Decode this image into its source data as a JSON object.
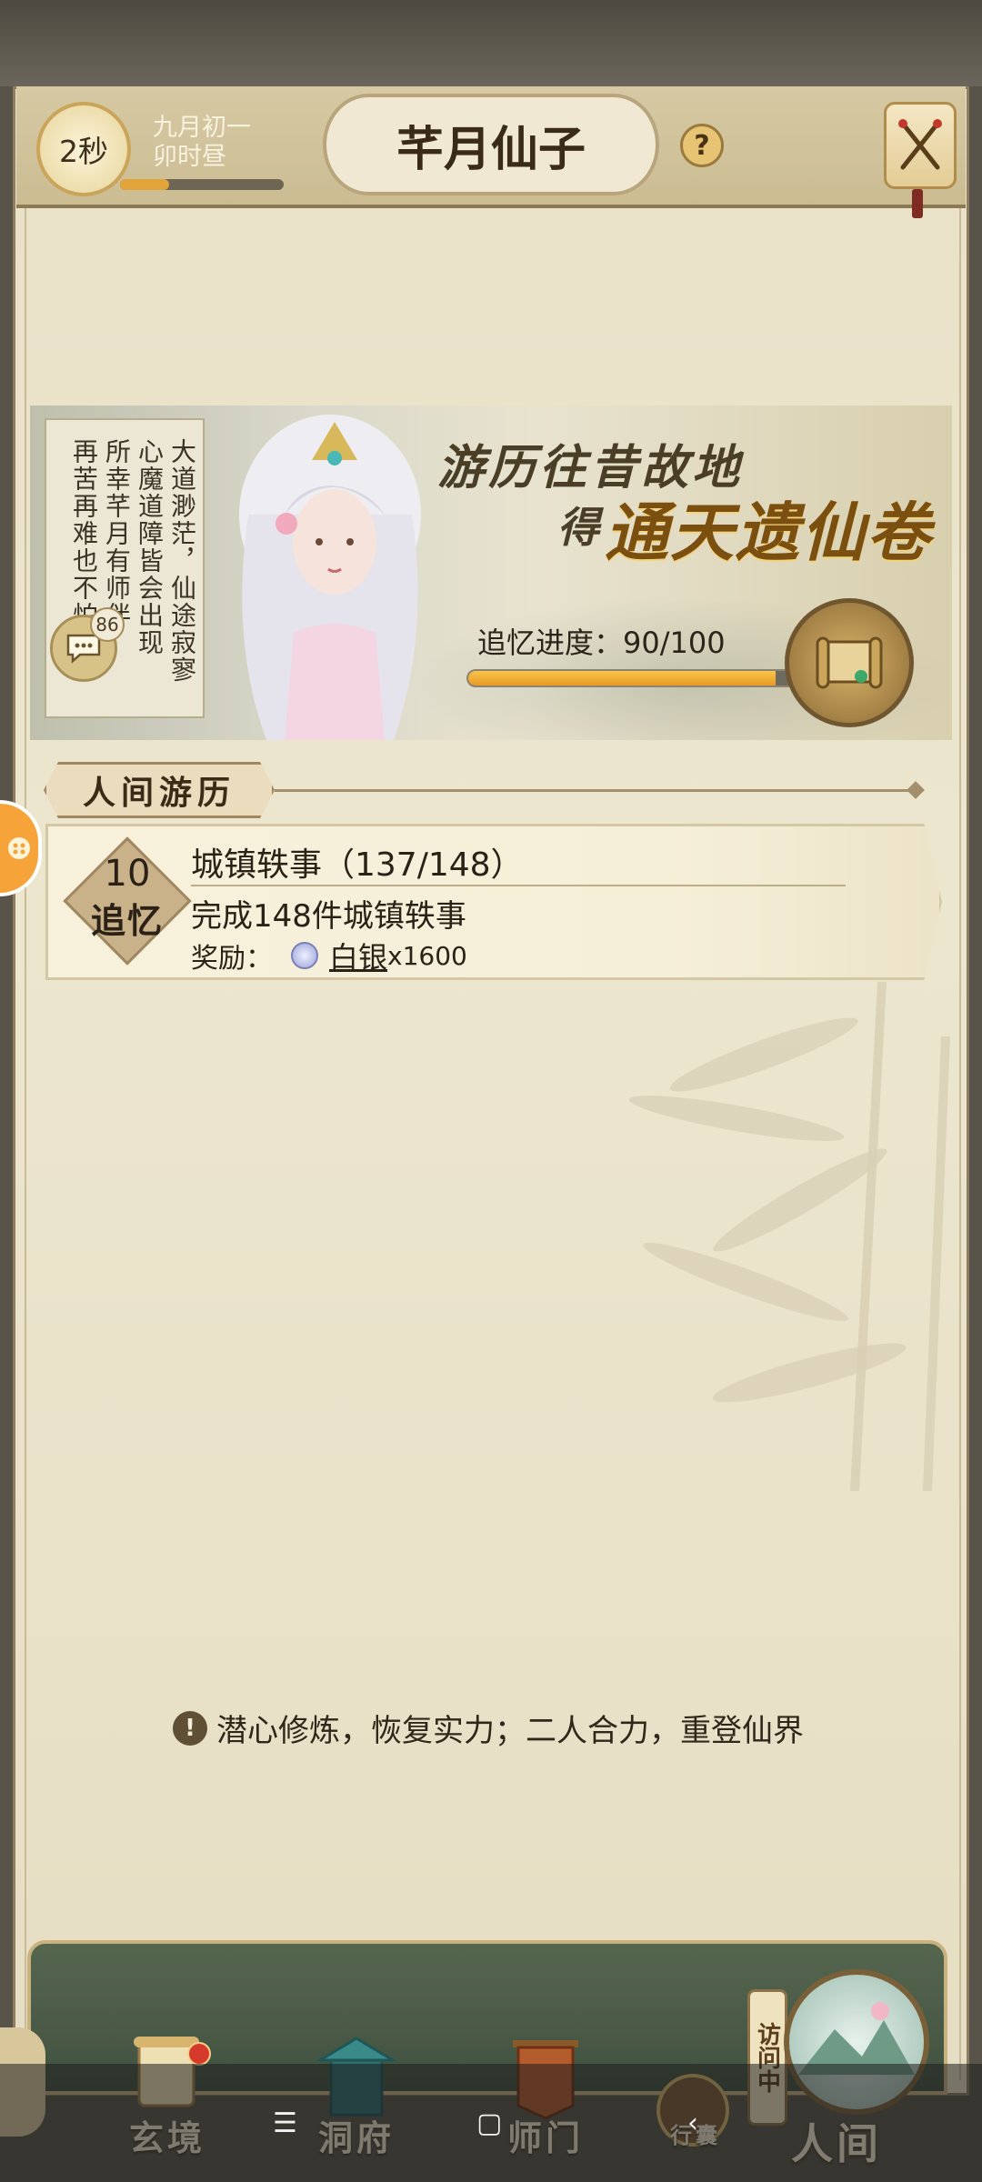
{
  "header": {
    "timer": "2秒",
    "date_line1": "九月初一",
    "date_line2": "卯时昼",
    "day_progress": 0.3,
    "title": "芊月仙子",
    "help_icon": "question-icon",
    "close_icon": "crossed-swords-icon"
  },
  "banner": {
    "poem_columns": [
      "大道渺茫，仙途寂寥",
      "心魔道障皆会出现",
      "所幸芊月有师伴",
      "再苦再难也不怕"
    ],
    "chat_badge": "86",
    "headline_line1": "游历往昔故地",
    "headline_line2_prefix": "得",
    "headline_line2_highlight": "通天遗仙卷",
    "progress_label": "追忆进度：90/100",
    "progress_current": 90,
    "progress_total": 100,
    "reward_icon": "scroll-icon"
  },
  "section": {
    "title": "人间游历"
  },
  "task": {
    "points": "10",
    "points_label": "追忆",
    "title": "城镇轶事（137/148）",
    "description": "完成148件城镇轶事",
    "reward_label": "奖励：",
    "reward_icon": "silver-coin-icon",
    "reward_name": "白银",
    "reward_qty": "x1600"
  },
  "hint": {
    "text": "潜心修炼，恢复实力；二人合力，重登仙界"
  },
  "bottom_nav": {
    "items": [
      {
        "label": "玄境",
        "icon": "scroll-icon"
      },
      {
        "label": "洞府",
        "icon": "pavilion-icon"
      },
      {
        "label": "师门",
        "icon": "banner-icon"
      },
      {
        "label": "行囊",
        "icon": "bag-icon"
      }
    ],
    "visiting": "访问中",
    "world": "人间"
  },
  "system_bar": {
    "menu": "☰",
    "home": "▢",
    "back": "‹"
  },
  "colors": {
    "accent_gold": "#e89a24",
    "frame": "#8d7d5e",
    "paper": "#ede6cf",
    "nav_green": "#4a5b48"
  }
}
